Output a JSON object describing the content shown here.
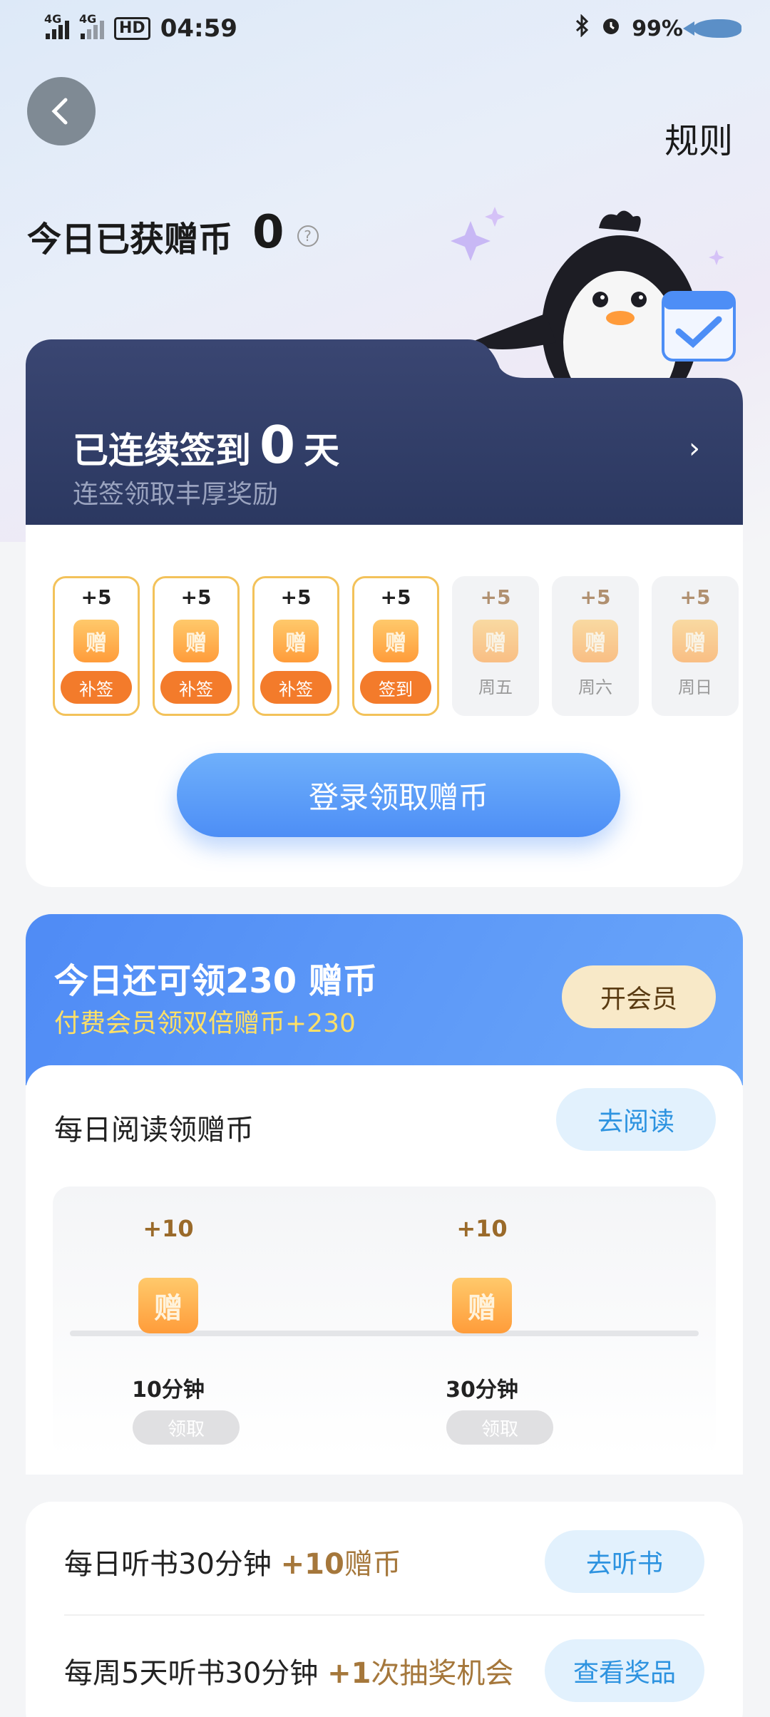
{
  "status_bar": {
    "net1": "4G",
    "net2": "4G",
    "hd": "HD",
    "time": "04:59",
    "battery": "99%"
  },
  "header": {
    "rules": "规则"
  },
  "today": {
    "label": "今日已获赠币",
    "value": "0",
    "help": "?"
  },
  "sign": {
    "prefix": "已连续签到",
    "days": "0",
    "suffix": "天",
    "subtitle": "连签领取丰厚奖励",
    "arrow": "›",
    "items": [
      {
        "points": "+5",
        "coin": "赠",
        "action": "补签"
      },
      {
        "points": "+5",
        "coin": "赠",
        "action": "补签"
      },
      {
        "points": "+5",
        "coin": "赠",
        "action": "补签"
      },
      {
        "points": "+5",
        "coin": "赠",
        "action": "签到"
      },
      {
        "points": "+5",
        "coin": "赠",
        "label": "周五"
      },
      {
        "points": "+5",
        "coin": "赠",
        "label": "周六"
      },
      {
        "points": "+5",
        "coin": "赠",
        "label": "周日"
      }
    ],
    "login_button": "登录领取赠币"
  },
  "member": {
    "title": "今日还可领230 赠币",
    "subtitle": "付费会员领双倍赠币+230",
    "vip_button": "开会员",
    "read_title": "每日阅读领赠币",
    "read_button": "去阅读",
    "milestones": [
      {
        "points": "+10",
        "coin": "赠",
        "time": "10分钟",
        "claim": "领取"
      },
      {
        "points": "+10",
        "coin": "赠",
        "time": "30分钟",
        "claim": "领取"
      }
    ]
  },
  "listen": {
    "task1_text": "每日听书30分钟 ",
    "task1_bonus_num": "+10",
    "task1_bonus_unit": "赠币",
    "task1_button": "去听书",
    "task2_text": "每周5天听书30分钟 ",
    "task2_bonus_num": "+1",
    "task2_bonus_unit": "次抽奖机会",
    "task2_button": "查看奖品"
  },
  "colors": {
    "accent_blue": "#4d8ef6",
    "orange": "#f37b2b",
    "dark_card": "#29365e",
    "gold_text": "#a5773b"
  }
}
